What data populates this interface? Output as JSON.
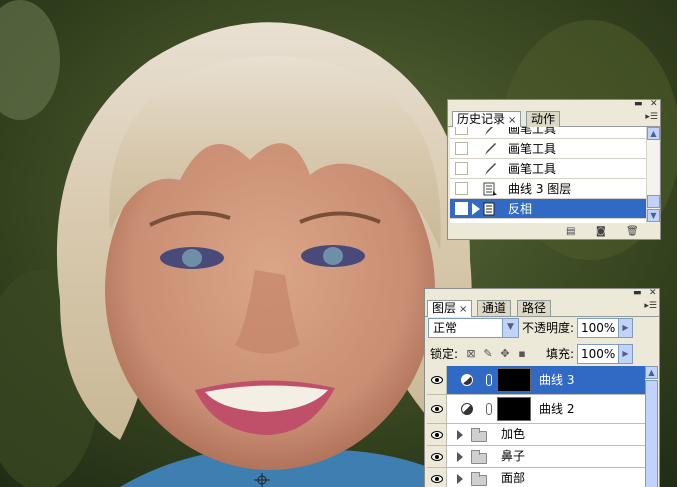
{
  "history_panel": {
    "tabs": [
      {
        "label": "历史记录",
        "close": "×",
        "active": true
      },
      {
        "label": "动作",
        "active": false
      }
    ],
    "items": [
      {
        "label": "画笔工具",
        "icon": "brush-icon"
      },
      {
        "label": "画笔工具",
        "icon": "brush-icon"
      },
      {
        "label": "画笔工具",
        "icon": "brush-icon"
      },
      {
        "label": "曲线 3 图层",
        "icon": "new-layer-state-icon"
      },
      {
        "label": "反相",
        "icon": "new-layer-state-icon",
        "selected": true
      }
    ],
    "footer_icons": [
      "new-document-from-state-icon",
      "new-snapshot-icon",
      "delete-icon"
    ]
  },
  "layers_panel": {
    "tabs": [
      {
        "label": "图层",
        "close": "×",
        "active": true
      },
      {
        "label": "通道",
        "active": false
      },
      {
        "label": "路径",
        "active": false
      }
    ],
    "blend_mode": "正常",
    "opacity_label": "不透明度:",
    "opacity_value": "100%",
    "lock_label": "锁定:",
    "fill_label": "填充:",
    "fill_value": "100%",
    "layers": [
      {
        "name": "曲线 3",
        "type": "adjustment",
        "visible": true,
        "selected": true
      },
      {
        "name": "曲线 2",
        "type": "adjustment",
        "visible": true,
        "selected": false
      },
      {
        "name": "加色",
        "type": "group",
        "visible": true
      },
      {
        "name": "鼻子",
        "type": "group",
        "visible": true
      },
      {
        "name": "面部",
        "type": "group",
        "visible": true
      }
    ]
  },
  "colors": {
    "selection": "#316ac5",
    "panel_bg": "#ece9d8",
    "scroll_accent": "#c1d3fb"
  }
}
